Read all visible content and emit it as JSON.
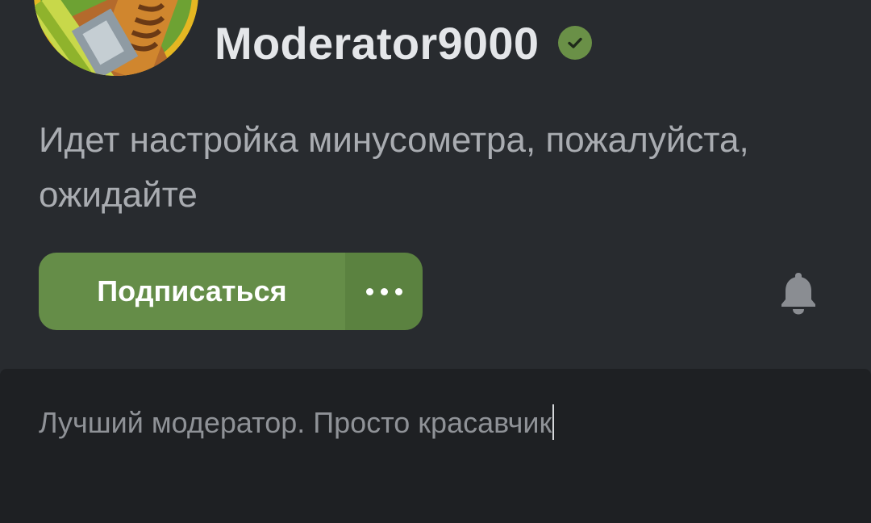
{
  "profile": {
    "username": "Moderator9000",
    "verified_icon": "verified-check-icon",
    "status": "Идет настройка минусометра, пожалуйста, ожидайте"
  },
  "actions": {
    "subscribe_label": "Подписаться",
    "more_icon": "more-dots-icon",
    "bell_icon": "bell-icon"
  },
  "comment": {
    "value": "Лучший модератор. Просто красавчик"
  },
  "colors": {
    "background": "#282b2f",
    "accent_green": "#658d48",
    "verified_green": "#6a9047",
    "input_background": "#1e2023"
  }
}
